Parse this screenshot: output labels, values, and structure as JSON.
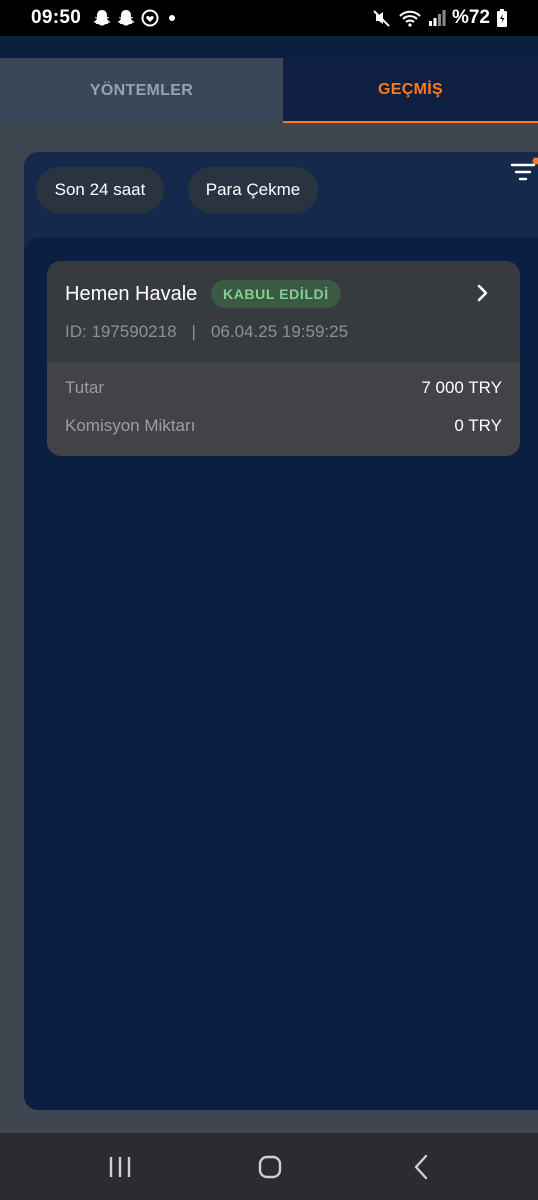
{
  "status_bar": {
    "time": "09:50",
    "battery": "%72",
    "left_icons": [
      "snapchat-icon",
      "snapchat-icon",
      "heart-app-icon",
      "dot-icon"
    ],
    "right_icons": [
      "mute-icon",
      "wifi-icon",
      "signal-icon",
      "battery-icon"
    ]
  },
  "tabs": [
    {
      "label": "YÖNTEMLER",
      "active": false
    },
    {
      "label": "GEÇMİŞ",
      "active": true
    }
  ],
  "filters": {
    "period": "Son 24 saat",
    "type": "Para Çekme",
    "has_active_filter_dot": true
  },
  "transactions": [
    {
      "method": "Hemen Havale",
      "status": "KABUL EDİLDİ",
      "id": "ID: 197590218",
      "separator": "|",
      "datetime": "06.04.25 19:59:25",
      "amount_label": "Tutar",
      "amount_value": "7 000 TRY",
      "fee_label": "Komisyon Miktarı",
      "fee_value": "0 TRY"
    }
  ],
  "colors": {
    "accent": "#ff7a1a",
    "status_accepted_bg": "#3a5a44",
    "status_accepted_text": "#86cf94",
    "panel_bg": "#15294d",
    "list_bg": "#0b1f42"
  },
  "nav": [
    "recent-apps-icon",
    "home-icon",
    "back-icon"
  ]
}
